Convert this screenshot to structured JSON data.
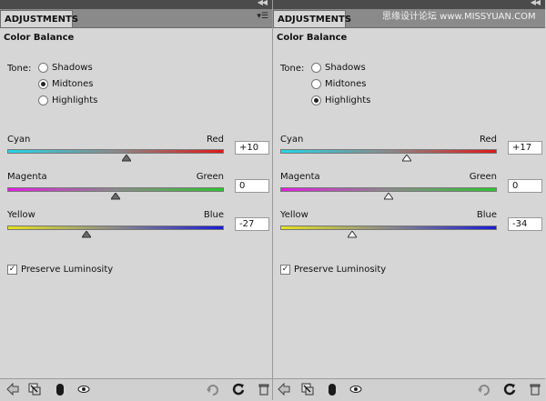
{
  "panels": [
    {
      "tab_label": "ADJUSTMENTS",
      "title": "Color Balance",
      "tone_label": "Tone:",
      "tones": [
        {
          "label": "Shadows",
          "selected": false
        },
        {
          "label": "Midtones",
          "selected": true
        },
        {
          "label": "Highlights",
          "selected": false
        }
      ],
      "sliders": [
        {
          "left_label": "Cyan",
          "right_label": "Red",
          "value": "+10",
          "num": 10,
          "min": -100,
          "max": 100,
          "left_color": "#26d4e6",
          "right_color": "#e01818",
          "thumb": "dark"
        },
        {
          "left_label": "Magenta",
          "right_label": "Green",
          "value": "0",
          "num": 0,
          "min": -100,
          "max": 100,
          "left_color": "#e21ee2",
          "right_color": "#2ec42e",
          "thumb": "dark"
        },
        {
          "left_label": "Yellow",
          "right_label": "Blue",
          "value": "-27",
          "num": -27,
          "min": -100,
          "max": 100,
          "left_color": "#e6e21e",
          "right_color": "#1a1ad8",
          "thumb": "dark"
        }
      ],
      "preserve_label": "Preserve Luminosity",
      "preserve_checked": true
    },
    {
      "tab_label": "ADJUSTMENTS",
      "title": "Color Balance",
      "tone_label": "Tone:",
      "tones": [
        {
          "label": "Shadows",
          "selected": false
        },
        {
          "label": "Midtones",
          "selected": false
        },
        {
          "label": "Highlights",
          "selected": true
        }
      ],
      "sliders": [
        {
          "left_label": "Cyan",
          "right_label": "Red",
          "value": "+17",
          "num": 17,
          "min": -100,
          "max": 100,
          "left_color": "#26d4e6",
          "right_color": "#e01818",
          "thumb": "light"
        },
        {
          "left_label": "Magenta",
          "right_label": "Green",
          "value": "0",
          "num": 0,
          "min": -100,
          "max": 100,
          "left_color": "#e21ee2",
          "right_color": "#2ec42e",
          "thumb": "light"
        },
        {
          "left_label": "Yellow",
          "right_label": "Blue",
          "value": "-34",
          "num": -34,
          "min": -100,
          "max": 100,
          "left_color": "#e6e21e",
          "right_color": "#1a1ad8",
          "thumb": "light"
        }
      ],
      "preserve_label": "Preserve Luminosity",
      "preserve_checked": true
    }
  ],
  "watermark": "思缘设计论坛 www.MISSYUAN.COM",
  "icons": [
    "back-arrow-icon",
    "clip-layer-icon",
    "visibility-toggle-icon",
    "eye-icon",
    "previous-state-icon",
    "reset-icon",
    "trash-icon"
  ]
}
